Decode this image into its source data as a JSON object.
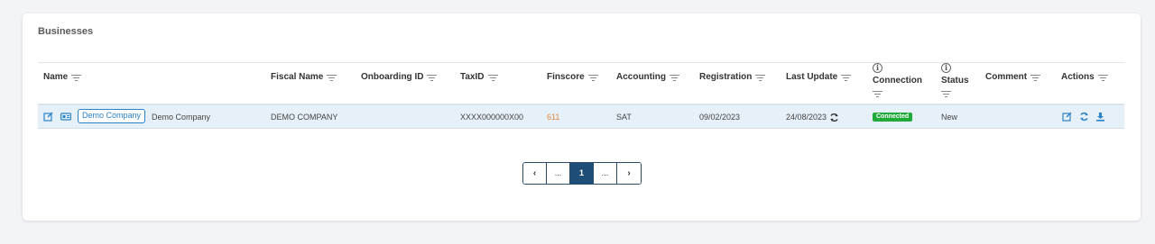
{
  "card": {
    "title": "Businesses"
  },
  "columns": {
    "name": "Name",
    "fiscal_name": "Fiscal Name",
    "onboarding_id": "Onboarding ID",
    "tax_id": "TaxID",
    "finscore": "Finscore",
    "accounting": "Accounting",
    "registration": "Registration",
    "last_update": "Last Update",
    "connection": "Connection",
    "status": "Status",
    "comment": "Comment",
    "actions": "Actions"
  },
  "row": {
    "name_button": "Demo Company",
    "name": "Demo Company",
    "fiscal_name": "DEMO COMPANY",
    "onboarding_id": "",
    "tax_id": "XXXX000000X00",
    "finscore": "611",
    "accounting": "SAT",
    "registration": "09/02/2023",
    "last_update": "24/08/2023",
    "connection": "Connected",
    "status": "New",
    "comment": ""
  },
  "pagination": {
    "prev": "‹",
    "ellipsis_left": "...",
    "current": "1",
    "ellipsis_right": "...",
    "next": "›"
  },
  "colors": {
    "accent": "#2a82c7",
    "connected": "#1faa3a",
    "finscore": "#e08a3a",
    "active_page": "#1d4e78"
  },
  "icons": [
    "edit-icon",
    "id-card-icon",
    "refresh-icon",
    "download-icon",
    "filter-icon",
    "info-icon"
  ]
}
